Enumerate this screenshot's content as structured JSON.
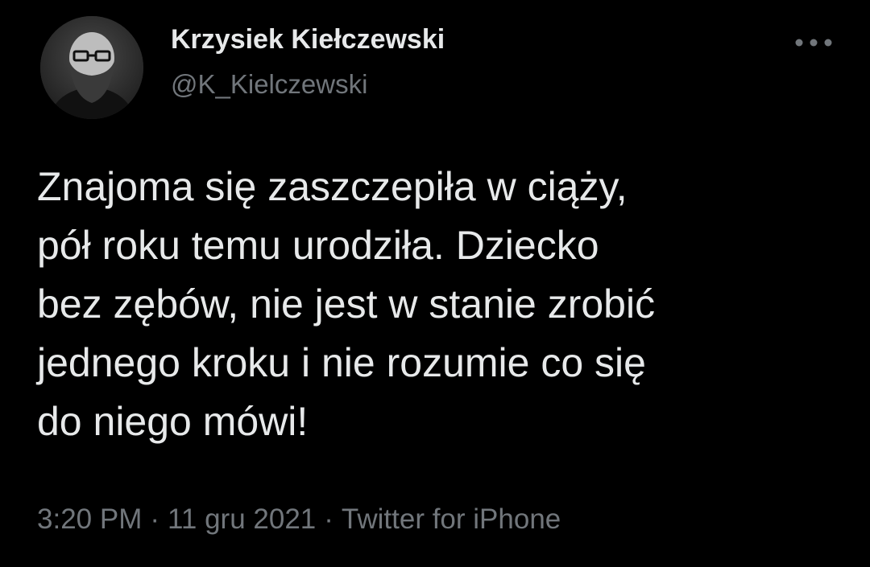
{
  "tweet": {
    "author": {
      "display_name": "Krzysiek Kiełczewski",
      "handle": "@K_Kielczewski",
      "avatar_icon": "bearded-man-with-glasses-avatar"
    },
    "more_icon": "more-options-icon",
    "text": "Znajoma się zaszczepiła w ciąży,\npół roku temu urodziła. Dziecko\nbez zębów, nie jest w stanie zrobić\njednego kroku i nie rozumie co się\ndo niego mówi!",
    "meta": {
      "time": "3:20 PM",
      "date": "11 gru 2021",
      "source": "Twitter for iPhone",
      "separator": "·"
    },
    "colors": {
      "background": "#000000",
      "primary_text": "#e7e9ea",
      "secondary_text": "#71767b"
    }
  }
}
